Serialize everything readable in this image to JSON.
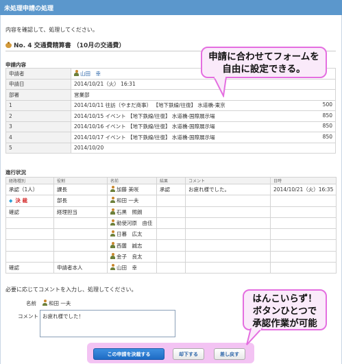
{
  "window": {
    "title": "未処理申請の処理"
  },
  "intro": "内容を確認して、処理してください。",
  "request": {
    "title": "No. 4 交通費精算書 （10月の交通費）"
  },
  "sections": {
    "content": "申請内容",
    "progress": "進行状況"
  },
  "info": {
    "applicant_label": "申請者",
    "applicant": "山田　幸",
    "date_label": "申請日",
    "date": "2014/10/21（火） 16:31",
    "dept_label": "部署",
    "dept": "営業部",
    "lines": [
      {
        "no": "1",
        "text": "2014/10/11 往訪（やまだ商事） 【地下鉄線/往復】 水道橋-東京",
        "amount": "500"
      },
      {
        "no": "2",
        "text": "2014/10/15 イベント 【地下鉄線/往復】 水道橋-国際展示場",
        "amount": "850"
      },
      {
        "no": "3",
        "text": "2014/10/16 イベント 【地下鉄線/往復】 水道橋-国際展示場",
        "amount": "850"
      },
      {
        "no": "4",
        "text": "2014/10/17 イベント 【地下鉄線/往復】 水道橋-国際展示場",
        "amount": "850"
      },
      {
        "no": "5",
        "text": "2014/10/20",
        "amount": ""
      }
    ]
  },
  "progress": {
    "headers": [
      "経路種別",
      "役割",
      "名前",
      "結果",
      "コメント",
      "日時"
    ],
    "row1": {
      "type": "承認（1人）",
      "role": "課長",
      "name": "加藤 美咲",
      "result": "承認",
      "comment": "お疲れ様でした。",
      "datetime": "2014/10/21（火）16:35"
    },
    "row2": {
      "type": "決 裁",
      "role": "部長",
      "name": "和田 一夫"
    },
    "row3": {
      "type": "確認",
      "role": "経理担当",
      "names": [
        "石黒　照朗",
        "勅使河原　由佳",
        "日暮　広太",
        "西薗　誠志",
        "金子　良太"
      ]
    },
    "row4": {
      "type": "確認",
      "role": "申請者本人",
      "name": "山田　幸"
    }
  },
  "form": {
    "note": "必要に応じてコメントを入力し、処理してください。",
    "name_label": "名前",
    "name_value": "和田 一夫",
    "comment_label": "コメント",
    "comment_value": "お疲れ様でした！"
  },
  "buttons": {
    "approve": "この申請を決裁する",
    "reject": "却下する",
    "return": "差し戻す"
  },
  "callouts": {
    "top_line1": "申請に合わせてフォームを",
    "top_line2": "自由に設定できる。",
    "bottom_line1": "はんこいらず！",
    "bottom_line2": "ボタンひとつで",
    "bottom_line3": "承認作業が可能"
  },
  "colors": {
    "titlebar": "#5b97cc",
    "primary_button": "#2a7ad6",
    "callout_border": "#e46ee0",
    "callout_fill": "#faeafa",
    "kessai": "#d42b2b"
  }
}
